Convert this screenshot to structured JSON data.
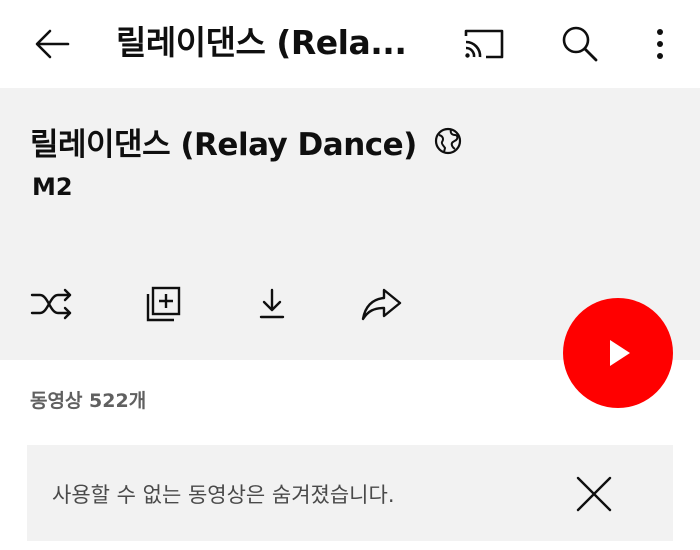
{
  "topbar": {
    "title": "릴레이댄스 (Rela...",
    "icons": {
      "back": "arrow-left-icon",
      "cast": "cast-icon",
      "search": "search-icon",
      "more": "more-vertical-icon"
    }
  },
  "playlist": {
    "title": "릴레이댄스 (Relay Dance)",
    "visibility_icon": "globe-icon",
    "channel": "M2",
    "video_count": "동영상 522개"
  },
  "actions": {
    "icons": [
      "shuffle-icon",
      "add-to-library-icon",
      "download-icon",
      "share-icon"
    ]
  },
  "play_button": {
    "icon": "play-icon",
    "color": "#ff0000"
  },
  "notice": {
    "text": "사용할 수 없는 동영상은 숨겨졌습니다.",
    "dismiss_icon": "close-icon"
  },
  "colors": {
    "header_bg": "#f2f2f2",
    "accent": "#ff0000",
    "muted_text": "#606060"
  }
}
